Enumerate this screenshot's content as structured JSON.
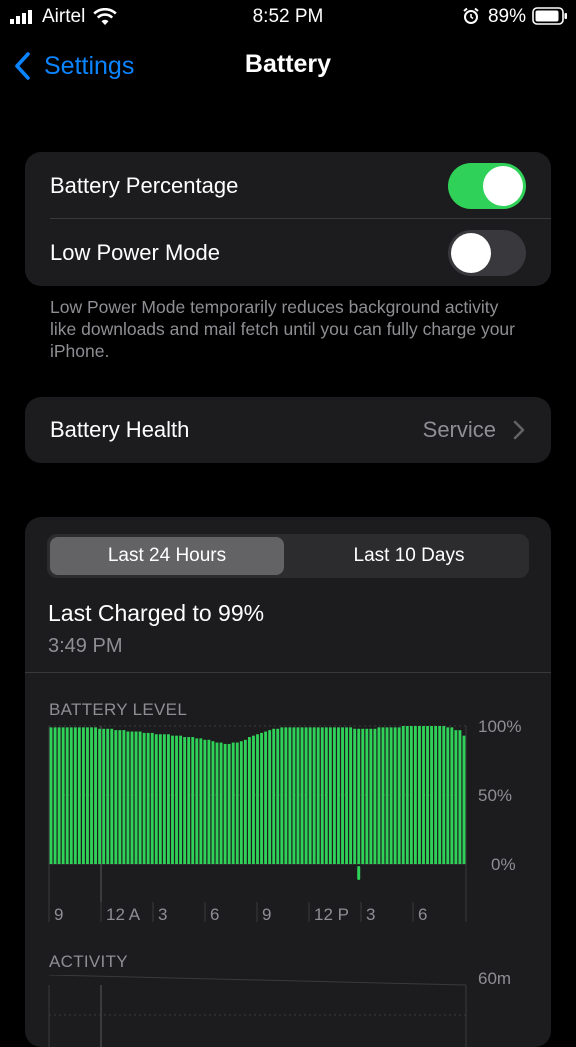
{
  "status_bar": {
    "carrier": "Airtel",
    "time": "8:52 PM",
    "battery_percent": "89%",
    "icons": [
      "signal-icon",
      "wifi-icon",
      "alarm-icon",
      "battery-icon"
    ]
  },
  "nav": {
    "back_label": "Settings",
    "title": "Battery"
  },
  "toggles": {
    "battery_percentage": {
      "label": "Battery Percentage",
      "on": true
    },
    "low_power_mode": {
      "label": "Low Power Mode",
      "on": false
    },
    "footnote": "Low Power Mode temporarily reduces background activity like downloads and mail fetch until you can fully charge your iPhone."
  },
  "battery_health": {
    "label": "Battery Health",
    "value": "Service"
  },
  "usage": {
    "tabs": [
      "Last 24 Hours",
      "Last 10 Days"
    ],
    "active_tab": 0,
    "last_charged": "Last Charged to 99%",
    "last_charged_time": "3:49 PM",
    "battery_level_label": "BATTERY LEVEL",
    "y_labels": [
      "100%",
      "50%",
      "0%"
    ],
    "x_labels": [
      "9",
      "12 A",
      "3",
      "6",
      "9",
      "12 P",
      "3",
      "6"
    ],
    "activity_label": "ACTIVITY",
    "activity_y_label": "60m"
  },
  "colors": {
    "accent": "#0a84ff",
    "toggle_on": "#30d158",
    "bar_green": "#30d158",
    "card_bg": "#1c1c1e",
    "secondary_text": "#8e8e93"
  },
  "chart_data": {
    "type": "bar",
    "title": "BATTERY LEVEL",
    "ylim": [
      0,
      100
    ],
    "y_ticks": [
      "100%",
      "50%",
      "0%"
    ],
    "x_tick_labels": [
      "9",
      "12 A",
      "3",
      "6",
      "9",
      "12 P",
      "3",
      "6"
    ],
    "values": [
      99,
      99,
      99,
      99,
      99,
      99,
      99,
      99,
      99,
      99,
      99,
      99,
      98,
      98,
      98,
      98,
      97,
      97,
      97,
      96,
      96,
      96,
      96,
      95,
      95,
      95,
      94,
      94,
      94,
      94,
      93,
      93,
      93,
      92,
      92,
      92,
      91,
      91,
      90,
      90,
      89,
      88,
      88,
      87,
      87,
      88,
      88,
      89,
      90,
      92,
      93,
      94,
      95,
      96,
      97,
      98,
      98,
      99,
      99,
      99,
      99,
      99,
      99,
      99,
      99,
      99,
      99,
      99,
      99,
      99,
      99,
      99,
      99,
      99,
      99,
      98,
      98,
      98,
      98,
      98,
      98,
      99,
      99,
      99,
      99,
      99,
      99,
      100,
      100,
      100,
      100,
      100,
      100,
      100,
      100,
      100,
      100,
      100,
      99,
      99,
      97,
      97,
      93
    ],
    "charging_marker_index": 76
  }
}
